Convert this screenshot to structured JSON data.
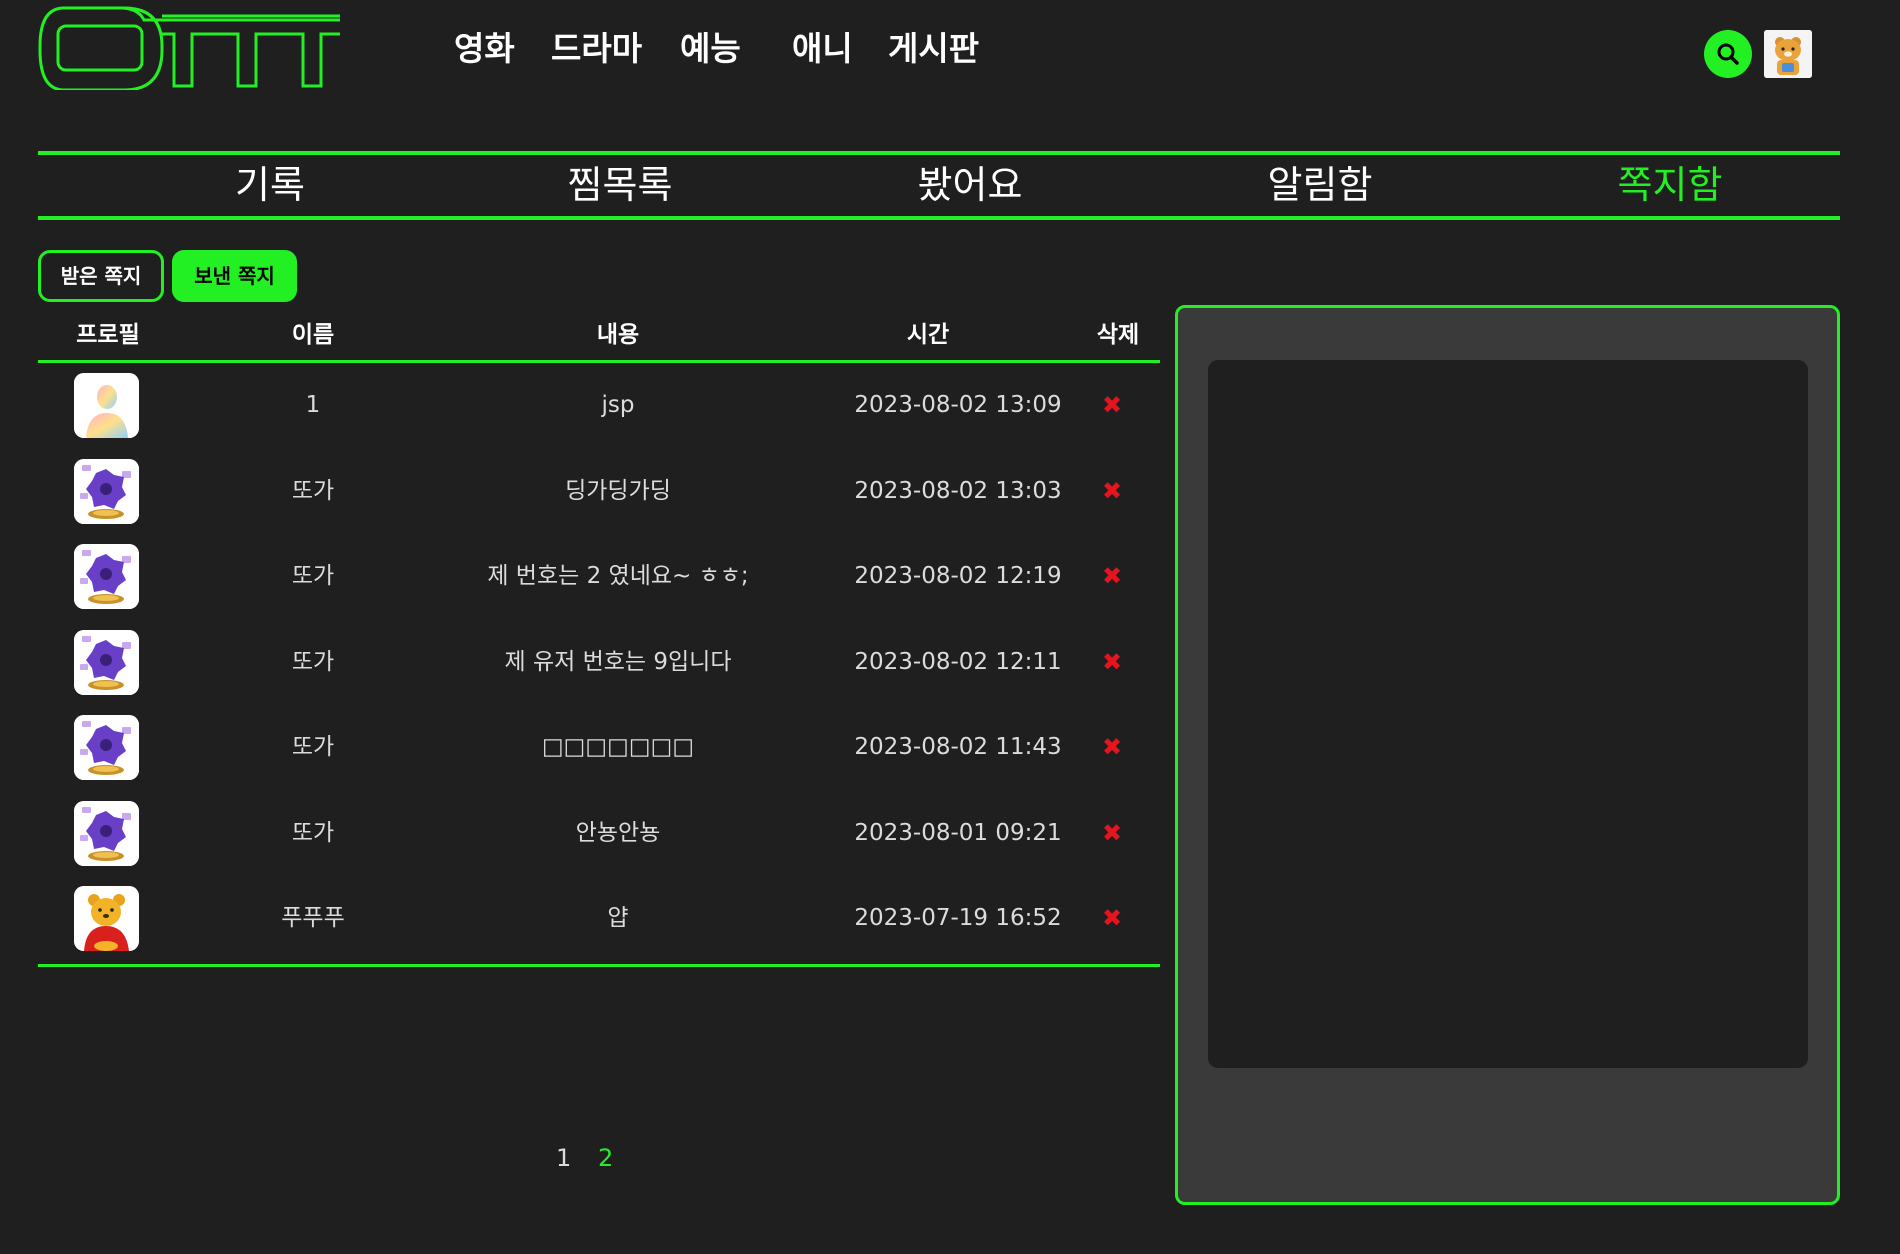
{
  "header": {
    "logo_text": "OTTT",
    "nav": [
      "영화",
      "드라마",
      "예능",
      "애니",
      "게시판"
    ]
  },
  "tabs": [
    "기록",
    "찜목록",
    "봤어요",
    "알림함",
    "쪽지함"
  ],
  "active_tab": "쪽지함",
  "message_buttons": {
    "received": "받은 쪽지",
    "sent": "보낸 쪽지"
  },
  "table": {
    "headers": [
      "프로필",
      "이름",
      "내용",
      "시간",
      "삭제"
    ],
    "rows": [
      {
        "avatar": "default-user-icon",
        "name": "1",
        "content": "jsp",
        "time": "2023-08-02 13:09"
      },
      {
        "avatar": "purple-gem-trophy-icon",
        "name": "또가",
        "content": "딩가딩가딩",
        "time": "2023-08-02 13:03"
      },
      {
        "avatar": "purple-gem-trophy-icon",
        "name": "또가",
        "content": "제 번호는 2 였네요~ ㅎㅎ;",
        "time": "2023-08-02 12:19"
      },
      {
        "avatar": "purple-gem-trophy-icon",
        "name": "또가",
        "content": "제 유저 번호는 9입니다",
        "time": "2023-08-02 12:11"
      },
      {
        "avatar": "purple-gem-trophy-icon",
        "name": "또가",
        "content": "□□□□□□□",
        "time": "2023-08-02 11:43"
      },
      {
        "avatar": "purple-gem-trophy-icon",
        "name": "또가",
        "content": "안뇽안뇽",
        "time": "2023-08-01 09:21"
      },
      {
        "avatar": "pooh-icon",
        "name": "푸푸푸",
        "content": "얍",
        "time": "2023-07-19 16:52"
      }
    ]
  },
  "pagination": {
    "pages": [
      "1",
      "2"
    ],
    "current": "2"
  },
  "colors": {
    "accent": "#22f022",
    "background": "#1f1f1f",
    "panel": "#3a3a3a",
    "delete": "#e6141e"
  }
}
